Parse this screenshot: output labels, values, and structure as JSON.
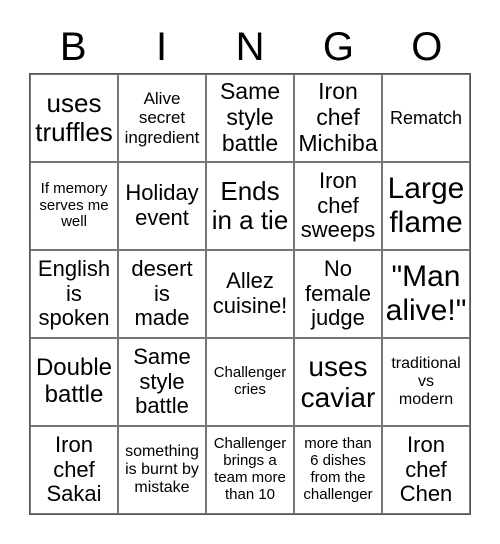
{
  "header": [
    "B",
    "I",
    "N",
    "G",
    "O"
  ],
  "cells": [
    "uses\ntruffles",
    "Alive\nsecret\ningredient",
    "Same\nstyle\nbattle",
    "Iron\nchef\nMichiba",
    "Rematch",
    "If memory\nserves me\nwell",
    "Holiday\nevent",
    "Ends\nin a tie",
    "Iron\nchef\nsweeps",
    "Large\nflame",
    "English\nis\nspoken",
    "desert\nis\nmade",
    "Allez\ncuisine!",
    "No\nfemale\njudge",
    "\"Man\nalive!\"",
    "Double\nbattle",
    "Same\nstyle\nbattle",
    "Challenger\ncries",
    "uses\ncaviar",
    "traditional\nvs\nmodern",
    "Iron\nchef\nSakai",
    "something\nis burnt by\nmistake",
    "Challenger\nbrings a\nteam more\nthan 10",
    "more than\n6 dishes\nfrom the\nchallenger",
    "Iron\nchef\nChen"
  ]
}
